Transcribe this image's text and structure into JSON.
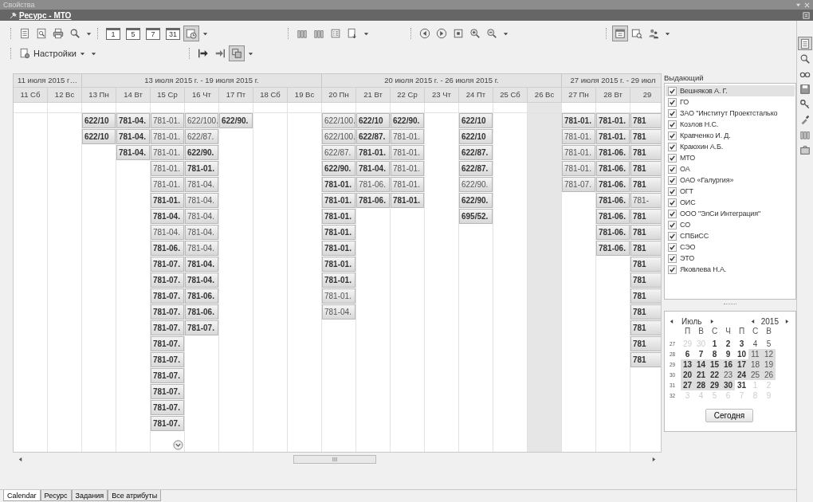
{
  "panel_title": "Свойства",
  "document_bar": {
    "title": "Ресурс - МТО"
  },
  "toolbar": {
    "rows": [
      {
        "groups": [
          {
            "buttons": [
              {
                "pressed": false
              },
              {
                "pressed": false
              },
              {
                "pressed": false
              },
              {
                "pressed": false
              }
            ]
          },
          {
            "buttons": [
              {
                "label": "1",
                "pressed": false
              },
              {
                "label": "5",
                "pressed": false
              },
              {
                "label": "7",
                "pressed": false
              },
              {
                "label": "31",
                "pressed": false
              },
              {
                "pressed": true
              }
            ]
          },
          {
            "buttons": [
              {
                "pressed": false
              },
              {
                "pressed": false
              },
              {
                "pressed": false
              },
              {
                "pressed": false
              }
            ]
          },
          {
            "buttons": [
              {
                "pressed": false
              },
              {
                "pressed": false
              },
              {
                "pressed": false
              },
              {
                "pressed": false
              },
              {
                "pressed": false
              }
            ]
          },
          {
            "buttons": [
              {
                "pressed": true
              },
              {
                "pressed": false
              },
              {
                "pressed": false
              }
            ]
          }
        ]
      },
      {
        "groups": [
          {
            "buttons": [
              {
                "label": "Настройки",
                "pressed": false
              }
            ]
          },
          {
            "buttons": [
              {
                "pressed": false
              },
              {
                "pressed": false
              },
              {
                "pressed": true
              }
            ]
          }
        ]
      }
    ]
  },
  "schedule": {
    "weeks": [
      {
        "label": "11 июля 2015 г…",
        "days": [
          {
            "label": "11 Сб",
            "shaded": false
          },
          {
            "label": "12 Вс",
            "shaded": false
          }
        ]
      },
      {
        "label": "13 июля 2015 г. - 19 июля 2015 г.",
        "days": [
          {
            "label": "13 Пн",
            "shaded": false,
            "events": [
              {
                "text": "622/10",
                "bold": true
              },
              {
                "text": "622/10",
                "bold": true
              }
            ]
          },
          {
            "label": "14 Вт",
            "shaded": false,
            "events": [
              {
                "text": "781-04.",
                "bold": true
              },
              {
                "text": "781-04.",
                "bold": true
              },
              {
                "text": "781-04.",
                "bold": true
              }
            ]
          },
          {
            "label": "15 Ср",
            "shaded": false,
            "events": [
              {
                "text": "781-01.",
                "bold": false
              },
              {
                "text": "781-01.",
                "bold": false
              },
              {
                "text": "781-01.",
                "bold": false
              },
              {
                "text": "781-01.",
                "bold": false
              },
              {
                "text": "781-01.",
                "bold": false
              },
              {
                "text": "781-01.",
                "bold": true
              },
              {
                "text": "781-04.",
                "bold": true
              },
              {
                "text": "781-04.",
                "bold": false
              },
              {
                "text": "781-06.",
                "bold": true
              },
              {
                "text": "781-07.",
                "bold": true
              },
              {
                "text": "781-07.",
                "bold": true
              },
              {
                "text": "781-07.",
                "bold": true
              },
              {
                "text": "781-07.",
                "bold": true
              },
              {
                "text": "781-07.",
                "bold": true
              },
              {
                "text": "781-07.",
                "bold": true
              },
              {
                "text": "781-07.",
                "bold": true
              },
              {
                "text": "781-07.",
                "bold": true
              },
              {
                "text": "781-07.",
                "bold": true
              },
              {
                "text": "781-07.",
                "bold": true
              },
              {
                "text": "781-07.",
                "bold": true
              }
            ]
          },
          {
            "label": "16 Чт",
            "shaded": false,
            "events": [
              {
                "text": "622/100.",
                "bold": false
              },
              {
                "text": "622/87.",
                "bold": false
              },
              {
                "text": "622/90.",
                "bold": true
              },
              {
                "text": "781-01.",
                "bold": true
              },
              {
                "text": "781-04.",
                "bold": false
              },
              {
                "text": "781-04.",
                "bold": false
              },
              {
                "text": "781-04.",
                "bold": false
              },
              {
                "text": "781-04.",
                "bold": false
              },
              {
                "text": "781-04.",
                "bold": false
              },
              {
                "text": "781-04.",
                "bold": true
              },
              {
                "text": "781-04.",
                "bold": true
              },
              {
                "text": "781-06.",
                "bold": true
              },
              {
                "text": "781-06.",
                "bold": true
              },
              {
                "text": "781-07.",
                "bold": true
              }
            ]
          },
          {
            "label": "17 Пт",
            "shaded": false,
            "events": [
              {
                "text": "622/90.",
                "bold": true
              }
            ]
          },
          {
            "label": "18 Сб",
            "shaded": false
          },
          {
            "label": "19 Вс",
            "shaded": false
          }
        ]
      },
      {
        "label": "20 июля 2015 г. - 26 июля 2015 г.",
        "days": [
          {
            "label": "20 Пн",
            "shaded": false,
            "events": [
              {
                "text": "622/100.",
                "bold": false
              },
              {
                "text": "622/100.",
                "bold": false
              },
              {
                "text": "622/87.",
                "bold": false
              },
              {
                "text": "622/90.",
                "bold": true
              },
              {
                "text": "781-01.",
                "bold": true
              },
              {
                "text": "781-01.",
                "bold": true
              },
              {
                "text": "781-01.",
                "bold": true
              },
              {
                "text": "781-01.",
                "bold": true
              },
              {
                "text": "781-01.",
                "bold": true
              },
              {
                "text": "781-01.",
                "bold": true
              },
              {
                "text": "781-01.",
                "bold": true
              },
              {
                "text": "781-01.",
                "bold": false
              },
              {
                "text": "781-04.",
                "bold": false
              }
            ]
          },
          {
            "label": "21 Вт",
            "shaded": false,
            "events": [
              {
                "text": "622/10",
                "bold": true
              },
              {
                "text": "622/87.",
                "bold": true
              },
              {
                "text": "781-01.",
                "bold": true
              },
              {
                "text": "781-04.",
                "bold": true
              },
              {
                "text": "781-06.",
                "bold": false
              },
              {
                "text": "781-06.",
                "bold": true
              }
            ]
          },
          {
            "label": "22 Ср",
            "shaded": false,
            "events": [
              {
                "text": "622/90.",
                "bold": true
              },
              {
                "text": "781-01.",
                "bold": false
              },
              {
                "text": "781-01.",
                "bold": false
              },
              {
                "text": "781-01.",
                "bold": false
              },
              {
                "text": "781-01.",
                "bold": false
              },
              {
                "text": "781-01.",
                "bold": true
              }
            ]
          },
          {
            "label": "23 Чт",
            "shaded": false
          },
          {
            "label": "24 Пт",
            "shaded": false,
            "events": [
              {
                "text": "622/10",
                "bold": true
              },
              {
                "text": "622/10",
                "bold": true
              },
              {
                "text": "622/87.",
                "bold": true
              },
              {
                "text": "622/87.",
                "bold": true
              },
              {
                "text": "622/90.",
                "bold": false
              },
              {
                "text": "622/90.",
                "bold": true
              },
              {
                "text": "695/52.",
                "bold": true
              }
            ]
          },
          {
            "label": "25 Сб",
            "shaded": false
          },
          {
            "label": "26 Вс",
            "shaded": true
          }
        ]
      },
      {
        "label": "27 июля 2015 г. - 29 июл",
        "days": [
          {
            "label": "27 Пн",
            "shaded": false,
            "events": [
              {
                "text": "781-01.",
                "bold": true
              },
              {
                "text": "781-01.",
                "bold": false
              },
              {
                "text": "781-01.",
                "bold": false
              },
              {
                "text": "781-01.",
                "bold": false
              },
              {
                "text": "781-07.",
                "bold": false
              }
            ]
          },
          {
            "label": "28 Вт",
            "shaded": false,
            "events": [
              {
                "text": "781-01.",
                "bold": true
              },
              {
                "text": "781-01.",
                "bold": true
              },
              {
                "text": "781-06.",
                "bold": true
              },
              {
                "text": "781-06.",
                "bold": true
              },
              {
                "text": "781-06.",
                "bold": true
              },
              {
                "text": "781-06.",
                "bold": true
              },
              {
                "text": "781-06.",
                "bold": true
              },
              {
                "text": "781-06.",
                "bold": true
              },
              {
                "text": "781-06.",
                "bold": true
              }
            ]
          },
          {
            "label": "29",
            "shaded": false,
            "events": [
              {
                "text": "781",
                "bold": true
              },
              {
                "text": "781",
                "bold": true
              },
              {
                "text": "781",
                "bold": true
              },
              {
                "text": "781",
                "bold": true
              },
              {
                "text": "781",
                "bold": true
              },
              {
                "text": "781-",
                "bold": false
              },
              {
                "text": "781",
                "bold": true
              },
              {
                "text": "781",
                "bold": true
              },
              {
                "text": "781",
                "bold": true
              },
              {
                "text": "781",
                "bold": true
              },
              {
                "text": "781",
                "bold": true
              },
              {
                "text": "781",
                "bold": true
              },
              {
                "text": "781",
                "bold": true
              },
              {
                "text": "781",
                "bold": true
              },
              {
                "text": "781",
                "bold": true
              },
              {
                "text": "781",
                "bold": true
              }
            ]
          }
        ]
      }
    ]
  },
  "filter": {
    "label": "Выдающий",
    "items": [
      {
        "label": "Вешняков А. Г.",
        "checked": true,
        "selected": true
      },
      {
        "label": "ГО",
        "checked": true,
        "selected": false
      },
      {
        "label": "ЗАО \"Институт Проектсталько",
        "checked": true,
        "selected": false
      },
      {
        "label": "Козлов Н.С.",
        "checked": true,
        "selected": false
      },
      {
        "label": "Кравченко И. Д.",
        "checked": true,
        "selected": false
      },
      {
        "label": "Краюхин А.Б.",
        "checked": true,
        "selected": false
      },
      {
        "label": "МТО",
        "checked": true,
        "selected": false
      },
      {
        "label": "ОА",
        "checked": true,
        "selected": false
      },
      {
        "label": "ОАО «Галургия»",
        "checked": true,
        "selected": false
      },
      {
        "label": "ОГТ",
        "checked": true,
        "selected": false
      },
      {
        "label": "ОИС",
        "checked": true,
        "selected": false
      },
      {
        "label": "ООО \"ЭлСи Интеграция\"",
        "checked": true,
        "selected": false
      },
      {
        "label": "СО",
        "checked": true,
        "selected": false
      },
      {
        "label": "СПБиСС",
        "checked": true,
        "selected": false
      },
      {
        "label": "СЭО",
        "checked": true,
        "selected": false
      },
      {
        "label": "ЭТО",
        "checked": true,
        "selected": false
      },
      {
        "label": "Яковлева Н.А.",
        "checked": true,
        "selected": false
      }
    ]
  },
  "mini_calendar": {
    "month": "Июль",
    "year": "2015",
    "weekdays": [
      "П",
      "В",
      "С",
      "Ч",
      "П",
      "С",
      "В"
    ],
    "weeks": [
      {
        "number": "27",
        "days": [
          {
            "label": "29",
            "other_month": true,
            "bold": false,
            "in_range": false
          },
          {
            "label": "30",
            "other_month": true,
            "bold": false,
            "in_range": false
          },
          {
            "label": "1",
            "other_month": false,
            "bold": true,
            "in_range": false
          },
          {
            "label": "2",
            "other_month": false,
            "bold": true,
            "in_range": false
          },
          {
            "label": "3",
            "other_month": false,
            "bold": true,
            "in_range": false
          },
          {
            "label": "4",
            "other_month": false,
            "bold": false,
            "in_range": false
          },
          {
            "label": "5",
            "other_month": false,
            "bold": false,
            "in_range": false
          }
        ]
      },
      {
        "number": "28",
        "days": [
          {
            "label": "6",
            "other_month": false,
            "bold": true,
            "in_range": false
          },
          {
            "label": "7",
            "other_month": false,
            "bold": true,
            "in_range": false
          },
          {
            "label": "8",
            "other_month": false,
            "bold": true,
            "in_range": false
          },
          {
            "label": "9",
            "other_month": false,
            "bold": true,
            "in_range": false
          },
          {
            "label": "10",
            "other_month": false,
            "bold": true,
            "in_range": false
          },
          {
            "label": "11",
            "other_month": false,
            "bold": false,
            "in_range": true
          },
          {
            "label": "12",
            "other_month": false,
            "bold": false,
            "in_range": true
          }
        ]
      },
      {
        "number": "29",
        "days": [
          {
            "label": "13",
            "other_month": false,
            "bold": true,
            "in_range": true
          },
          {
            "label": "14",
            "other_month": false,
            "bold": true,
            "in_range": true
          },
          {
            "label": "15",
            "other_month": false,
            "bold": true,
            "in_range": true
          },
          {
            "label": "16",
            "other_month": false,
            "bold": true,
            "in_range": true
          },
          {
            "label": "17",
            "other_month": false,
            "bold": true,
            "in_range": true
          },
          {
            "label": "18",
            "other_month": false,
            "bold": false,
            "in_range": true
          },
          {
            "label": "19",
            "other_month": false,
            "bold": false,
            "in_range": true
          }
        ]
      },
      {
        "number": "30",
        "days": [
          {
            "label": "20",
            "other_month": false,
            "bold": true,
            "in_range": true
          },
          {
            "label": "21",
            "other_month": false,
            "bold": true,
            "in_range": true
          },
          {
            "label": "22",
            "other_month": false,
            "bold": true,
            "in_range": true
          },
          {
            "label": "23",
            "other_month": false,
            "bold": false,
            "in_range": true
          },
          {
            "label": "24",
            "other_month": false,
            "bold": true,
            "in_range": true
          },
          {
            "label": "25",
            "other_month": false,
            "bold": false,
            "in_range": true
          },
          {
            "label": "26",
            "other_month": false,
            "bold": false,
            "in_range": true
          }
        ]
      },
      {
        "number": "31",
        "days": [
          {
            "label": "27",
            "other_month": false,
            "bold": true,
            "in_range": true
          },
          {
            "label": "28",
            "other_month": false,
            "bold": true,
            "in_range": true
          },
          {
            "label": "29",
            "other_month": false,
            "bold": true,
            "in_range": true
          },
          {
            "label": "30",
            "other_month": false,
            "bold": true,
            "in_range": true
          },
          {
            "label": "31",
            "other_month": false,
            "bold": true,
            "in_range": false
          },
          {
            "label": "1",
            "other_month": true,
            "bold": false,
            "in_range": false
          },
          {
            "label": "2",
            "other_month": true,
            "bold": false,
            "in_range": false
          }
        ]
      },
      {
        "number": "32",
        "days": [
          {
            "label": "3",
            "other_month": true,
            "bold": false,
            "in_range": false
          },
          {
            "label": "4",
            "other_month": true,
            "bold": false,
            "in_range": false
          },
          {
            "label": "5",
            "other_month": true,
            "bold": false,
            "in_range": false
          },
          {
            "label": "6",
            "other_month": true,
            "bold": false,
            "in_range": false
          },
          {
            "label": "7",
            "other_month": true,
            "bold": false,
            "in_range": false
          },
          {
            "label": "8",
            "other_month": true,
            "bold": false,
            "in_range": false
          },
          {
            "label": "9",
            "other_month": true,
            "bold": false,
            "in_range": false
          }
        ]
      }
    ],
    "today_button": "Сегодня"
  },
  "side_toolbar": [
    {
      "pressed": true
    },
    {
      "pressed": false
    },
    {
      "pressed": false
    },
    {
      "pressed": false
    },
    {
      "pressed": false
    },
    {
      "pressed": false
    },
    {
      "pressed": false
    },
    {
      "pressed": false
    }
  ],
  "bottom_tabs": [
    {
      "label": "Calendar",
      "selected": true
    },
    {
      "label": "Ресурс",
      "selected": false
    },
    {
      "label": "Задания",
      "selected": false
    },
    {
      "label": "Все атрибуты",
      "selected": false
    }
  ]
}
